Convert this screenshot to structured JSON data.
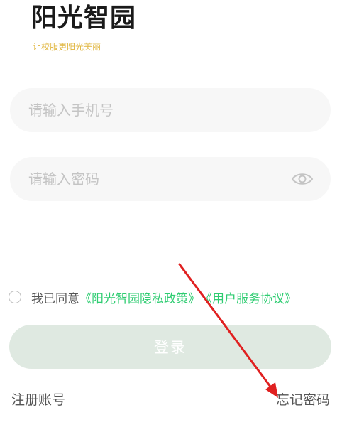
{
  "header": {
    "title": "阳光智园",
    "slogan": "让校服更阳光美丽"
  },
  "form": {
    "phone_placeholder": "请输入手机号",
    "password_placeholder": "请输入密码",
    "password_icon": "eye-icon"
  },
  "agreement": {
    "prefix": "我已同意",
    "privacy_link": "《阳光智园隐私政策》",
    "service_link": "《用户服务协议》",
    "checked": false
  },
  "actions": {
    "login_label": "登录",
    "register_label": "注册账号",
    "forgot_label": "忘记密码"
  },
  "colors": {
    "slogan": "#e0b43a",
    "link": "#2ecc71",
    "login_button_bg": "#dfe9e1",
    "input_bg": "#f7f7f7",
    "annotation_arrow": "#e02020"
  }
}
